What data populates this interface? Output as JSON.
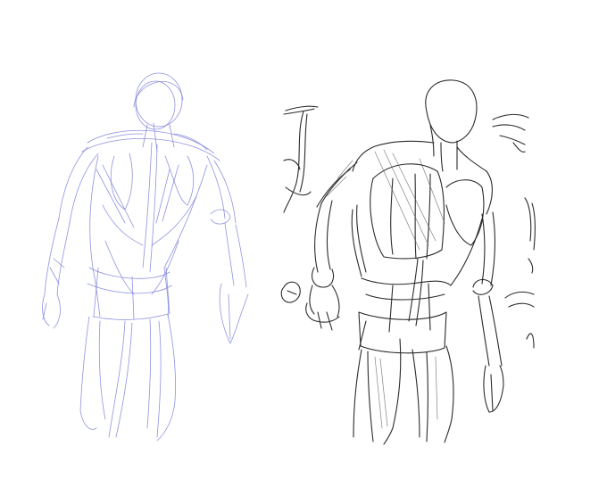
{
  "image": {
    "background": "#ffffff",
    "colors": {
      "rough_sketch_stroke": "#7b7fd8",
      "refined_sketch_stroke": "#2b2b2b"
    }
  }
}
